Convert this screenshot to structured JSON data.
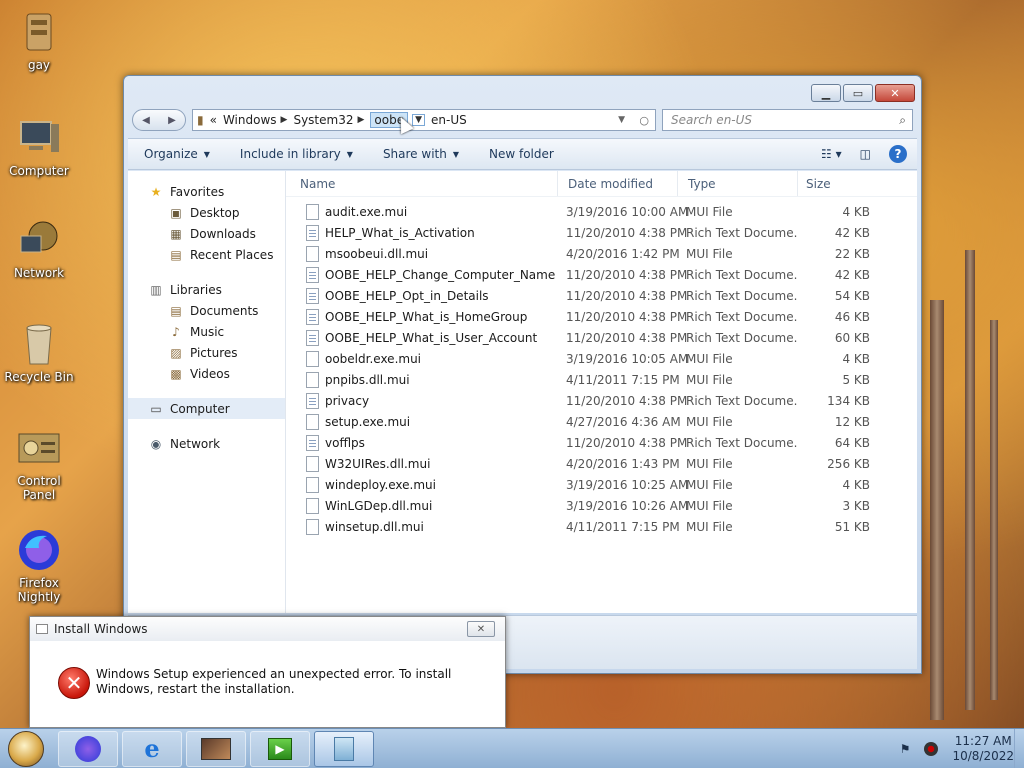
{
  "desktop": {
    "icons": [
      {
        "label": "gay",
        "icon": "user-folder-icon"
      },
      {
        "label": "Computer",
        "icon": "computer-icon"
      },
      {
        "label": "Network",
        "icon": "network-icon"
      },
      {
        "label": "Recycle Bin",
        "icon": "recycle-bin-icon"
      },
      {
        "label": "Control Panel",
        "icon": "control-panel-icon"
      },
      {
        "label": "Firefox Nightly",
        "icon": "firefox-nightly-icon"
      }
    ]
  },
  "explorer": {
    "address": {
      "chevron": "«",
      "crumbs": [
        "Windows",
        "System32",
        "oobe",
        "en-US"
      ],
      "selected_crumb_index": 2
    },
    "search": {
      "placeholder": "Search en-US"
    },
    "toolbar": {
      "organize": "Organize",
      "include_in_library": "Include in library",
      "share_with": "Share with",
      "new_folder": "New folder"
    },
    "nav": {
      "favorites": {
        "label": "Favorites",
        "items": [
          "Desktop",
          "Downloads",
          "Recent Places"
        ]
      },
      "libraries": {
        "label": "Libraries",
        "items": [
          "Documents",
          "Music",
          "Pictures",
          "Videos"
        ]
      },
      "computer": "Computer",
      "network": "Network"
    },
    "columns": {
      "name": "Name",
      "date": "Date modified",
      "type": "Type",
      "size": "Size"
    },
    "files": [
      {
        "name": "audit.exe.mui",
        "date": "3/19/2016 10:00 AM",
        "type": "MUI File",
        "size": "4 KB"
      },
      {
        "name": "HELP_What_is_Activation",
        "date": "11/20/2010 4:38 PM",
        "type": "Rich Text Docume...",
        "size": "42 KB"
      },
      {
        "name": "msoobeui.dll.mui",
        "date": "4/20/2016 1:42 PM",
        "type": "MUI File",
        "size": "22 KB"
      },
      {
        "name": "OOBE_HELP_Change_Computer_Name",
        "date": "11/20/2010 4:38 PM",
        "type": "Rich Text Docume...",
        "size": "42 KB"
      },
      {
        "name": "OOBE_HELP_Opt_in_Details",
        "date": "11/20/2010 4:38 PM",
        "type": "Rich Text Docume...",
        "size": "54 KB"
      },
      {
        "name": "OOBE_HELP_What_is_HomeGroup",
        "date": "11/20/2010 4:38 PM",
        "type": "Rich Text Docume...",
        "size": "46 KB"
      },
      {
        "name": "OOBE_HELP_What_is_User_Account",
        "date": "11/20/2010 4:38 PM",
        "type": "Rich Text Docume...",
        "size": "60 KB"
      },
      {
        "name": "oobeldr.exe.mui",
        "date": "3/19/2016 10:05 AM",
        "type": "MUI File",
        "size": "4 KB"
      },
      {
        "name": "pnpibs.dll.mui",
        "date": "4/11/2011 7:15 PM",
        "type": "MUI File",
        "size": "5 KB"
      },
      {
        "name": "privacy",
        "date": "11/20/2010 4:38 PM",
        "type": "Rich Text Docume...",
        "size": "134 KB"
      },
      {
        "name": "setup.exe.mui",
        "date": "4/27/2016 4:36 AM",
        "type": "MUI File",
        "size": "12 KB"
      },
      {
        "name": "vofflps",
        "date": "11/20/2010 4:38 PM",
        "type": "Rich Text Docume...",
        "size": "64 KB"
      },
      {
        "name": "W32UIRes.dll.mui",
        "date": "4/20/2016 1:43 PM",
        "type": "MUI File",
        "size": "256 KB"
      },
      {
        "name": "windeploy.exe.mui",
        "date": "3/19/2016 10:25 AM",
        "type": "MUI File",
        "size": "4 KB"
      },
      {
        "name": "WinLGDep.dll.mui",
        "date": "3/19/2016 10:26 AM",
        "type": "MUI File",
        "size": "3 KB"
      },
      {
        "name": "winsetup.dll.mui",
        "date": "4/11/2011 7:15 PM",
        "type": "MUI File",
        "size": "51 KB"
      }
    ]
  },
  "dialog": {
    "title": "Install Windows",
    "message": "Windows Setup experienced an unexpected error. To install Windows, restart the installation."
  },
  "taskbar": {
    "apps": [
      "firefox-nightly-icon",
      "internet-explorer-icon",
      "photos-icon",
      "media-player-icon",
      "install-windows-icon"
    ],
    "active_index": 4,
    "clock": {
      "time": "11:27 AM",
      "date": "10/8/2022"
    }
  },
  "colors": {
    "accent": "#2a6fc9",
    "error": "#c8160a"
  }
}
